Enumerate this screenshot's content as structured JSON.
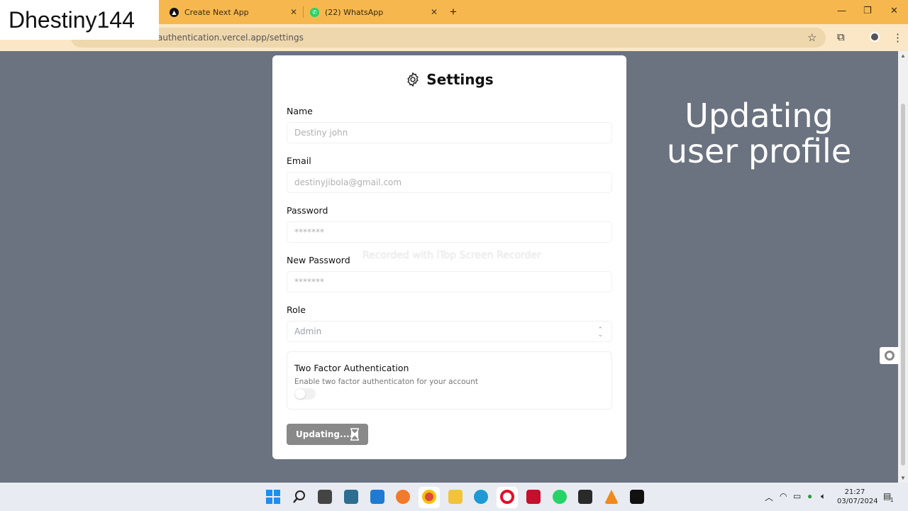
{
  "overlay": {
    "channel": "Dhestiny144"
  },
  "browser": {
    "tabs": [
      {
        "title": "Create Next App"
      },
      {
        "title": "(22) WhatsApp"
      }
    ],
    "url": "authentication.vercel.app/settings"
  },
  "page": {
    "title": "Settings",
    "fields": {
      "name": {
        "label": "Name",
        "placeholder": "Destiny john"
      },
      "email": {
        "label": "Email",
        "placeholder": "destinyjibola@gmail.com"
      },
      "password": {
        "label": "Password",
        "placeholder": "*******"
      },
      "new_password": {
        "label": "New Password",
        "placeholder": "*******"
      },
      "role": {
        "label": "Role",
        "value": "Admin"
      }
    },
    "two_factor": {
      "title": "Two Factor Authentication",
      "description": "Enable two factor authenticaton for your account",
      "enabled": false
    },
    "submit_label": "Updating....",
    "watermark": "Recorded with iTop Screen Recorder"
  },
  "caption": "Updating user profile",
  "taskbar": {
    "time": "21:27",
    "date": "03/07/2024",
    "notification_count": "1"
  },
  "colors": {
    "tab_bar": "#f6b84e",
    "page_background": "#6b7280",
    "button_disabled": "#898989"
  }
}
